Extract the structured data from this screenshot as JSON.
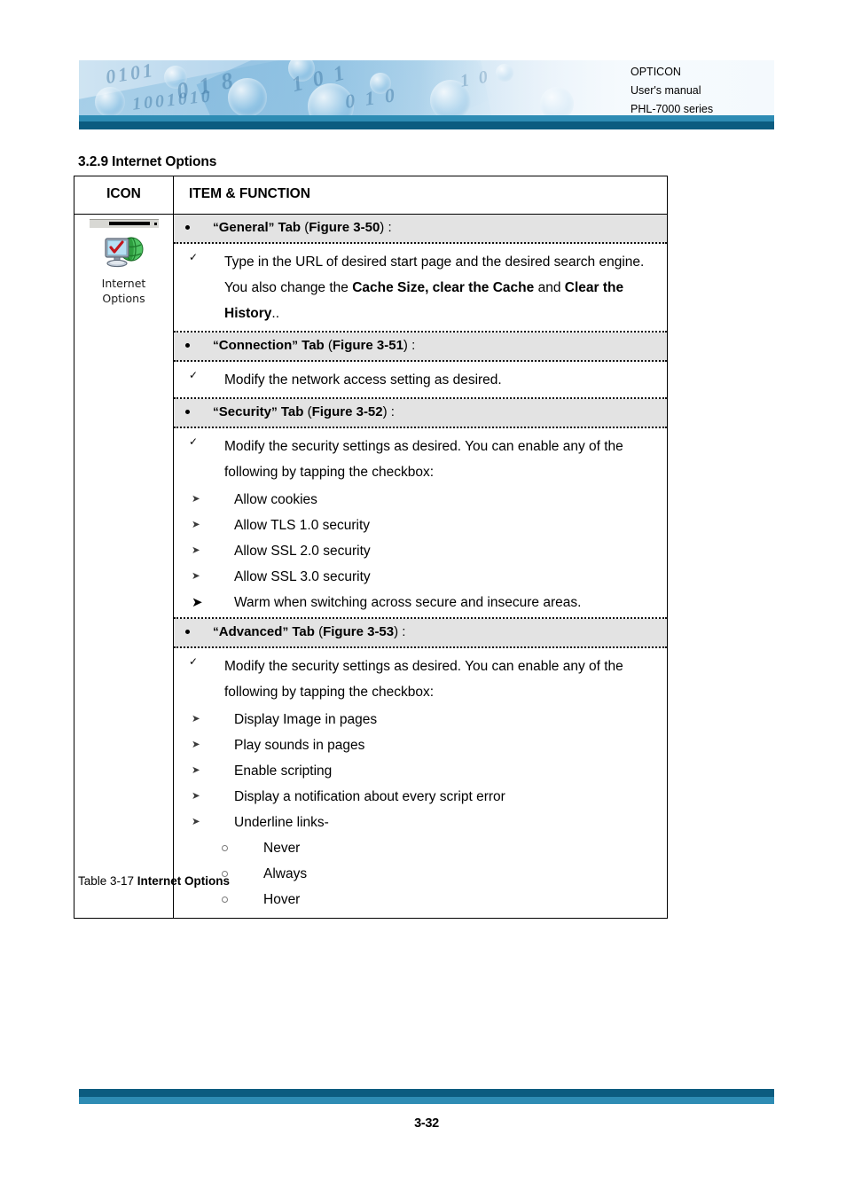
{
  "header": {
    "company": "OPTICON",
    "doc_type": "User's manual",
    "product": "PHL-7000 series",
    "bar_color_teal": "#2e8cb4",
    "bar_color_navy": "#0c5c80"
  },
  "section": {
    "number": "3.2.9",
    "heading": "3.2.9 Internet Options"
  },
  "table": {
    "columns": {
      "icon": "ICON",
      "item_function": "ITEM & FUNCTION"
    },
    "icon_cell": {
      "icon_name": "internet-options-icon",
      "caption_line1": "Internet",
      "caption_line2": "Options"
    },
    "sections": [
      {
        "band": {
          "quote_open": "“",
          "tab_name": "General",
          "quote_close": "”",
          "tab_word": " Tab ",
          "paren_open": "(",
          "figure": "Figure 3-50",
          "paren_close": ") :"
        },
        "paragraphs": [
          {
            "marker": "check",
            "runs": [
              {
                "text": "Type in the URL of desired start page and the desired search engine. You also change the ",
                "bold": false
              },
              {
                "text": "Cache Size, clear the Cache",
                "bold": true
              },
              {
                "text": " and ",
                "bold": false
              },
              {
                "text": "Clear the History",
                "bold": true
              },
              {
                "text": "..",
                "bold": false
              }
            ]
          }
        ],
        "sub_items": [],
        "sub_sub_items": []
      },
      {
        "band": {
          "quote_open": "“",
          "tab_name": "Connection",
          "quote_close": "”",
          "tab_word": " Tab ",
          "paren_open": "(",
          "figure": "Figure 3-51",
          "paren_close": ") :"
        },
        "paragraphs": [
          {
            "marker": "check",
            "runs": [
              {
                "text": "Modify the network access setting as desired.",
                "bold": false
              }
            ]
          }
        ],
        "sub_items": [],
        "sub_sub_items": []
      },
      {
        "band": {
          "quote_open": "“",
          "tab_name": "Security",
          "quote_close": "”",
          "tab_word": " Tab ",
          "paren_open": "(",
          "figure": "Figure 3-52",
          "paren_close": ") :"
        },
        "paragraphs": [
          {
            "marker": "check",
            "runs": [
              {
                "text": "Modify the security settings as desired. You can enable any of the following by tapping the checkbox:",
                "bold": false
              }
            ]
          }
        ],
        "sub_items": [
          {
            "text": "Allow cookies",
            "big": false
          },
          {
            "text": "Allow TLS 1.0 security",
            "big": false
          },
          {
            "text": "Allow SSL 2.0 security",
            "big": false
          },
          {
            "text": "Allow SSL 3.0 security",
            "big": false
          },
          {
            "text": "Warm when switching across secure and insecure areas.",
            "big": true
          }
        ],
        "sub_sub_items": []
      },
      {
        "band": {
          "quote_open": "“",
          "tab_name": "Advanced",
          "quote_close": "”",
          "tab_word": " Tab ",
          "paren_open": "(",
          "figure": "Figure 3-53",
          "paren_close": ") :"
        },
        "paragraphs": [
          {
            "marker": "check",
            "runs": [
              {
                "text": "Modify the security settings as desired. You can enable any of the following by tapping the checkbox:",
                "bold": false
              }
            ]
          }
        ],
        "sub_items": [
          {
            "text": "Display Image in pages",
            "big": false
          },
          {
            "text": "Play sounds in pages",
            "big": false
          },
          {
            "text": "Enable scripting",
            "big": false
          },
          {
            "text": "Display a notification about every script error",
            "big": false
          },
          {
            "text": "Underline links-",
            "big": false
          }
        ],
        "sub_sub_items": [
          {
            "text": "Never"
          },
          {
            "text": "Always"
          },
          {
            "text": "Hover"
          }
        ]
      }
    ]
  },
  "caption": {
    "prefix": "Table 3-17 ",
    "bold_part": "Internet Options"
  },
  "footer": {
    "page_number": "3-32"
  }
}
